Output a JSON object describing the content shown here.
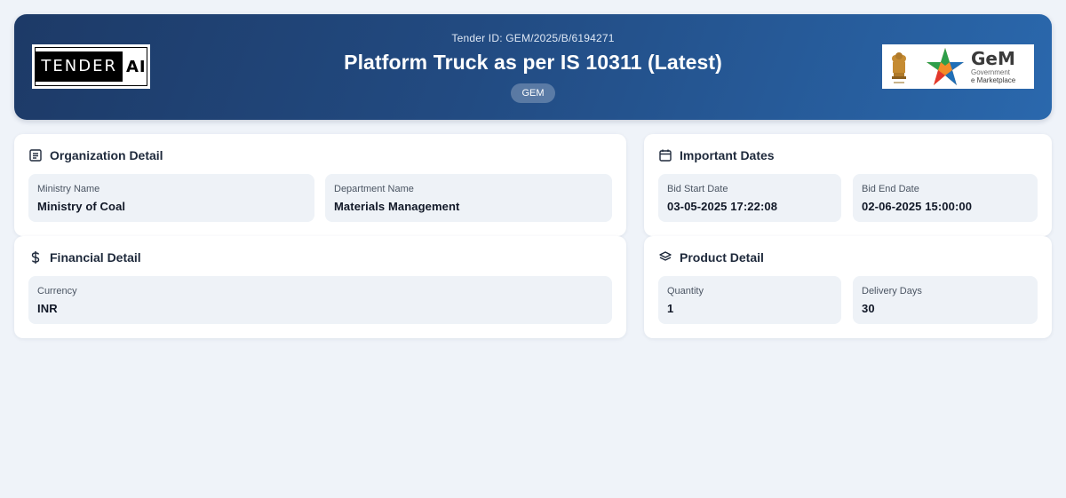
{
  "header": {
    "tender_id": "Tender ID: GEM/2025/B/6194271",
    "title": "Platform Truck as per IS 10311 (Latest)",
    "badge": "GEM",
    "brand_left": {
      "tender": "TENDER",
      "ai": "AI"
    },
    "brand_right": {
      "word": "GeM",
      "line1": "Government",
      "line2": "e Marketplace"
    }
  },
  "organization": {
    "title": "Organization Detail",
    "icon": "list-icon",
    "fields": [
      {
        "label": "Ministry Name",
        "value": "Ministry of Coal"
      },
      {
        "label": "Department Name",
        "value": "Materials Management"
      }
    ]
  },
  "dates": {
    "title": "Important Dates",
    "icon": "calendar-icon",
    "fields": [
      {
        "label": "Bid Start Date",
        "value": "03-05-2025 17:22:08"
      },
      {
        "label": "Bid End Date",
        "value": "02-06-2025 15:00:00"
      }
    ]
  },
  "financial": {
    "title": "Financial Detail",
    "icon": "dollar-icon",
    "fields": [
      {
        "label": "Currency",
        "value": "INR"
      }
    ]
  },
  "product": {
    "title": "Product Detail",
    "icon": "layers-icon",
    "fields": [
      {
        "label": "Quantity",
        "value": "1"
      },
      {
        "label": "Delivery Days",
        "value": "30"
      }
    ]
  }
}
